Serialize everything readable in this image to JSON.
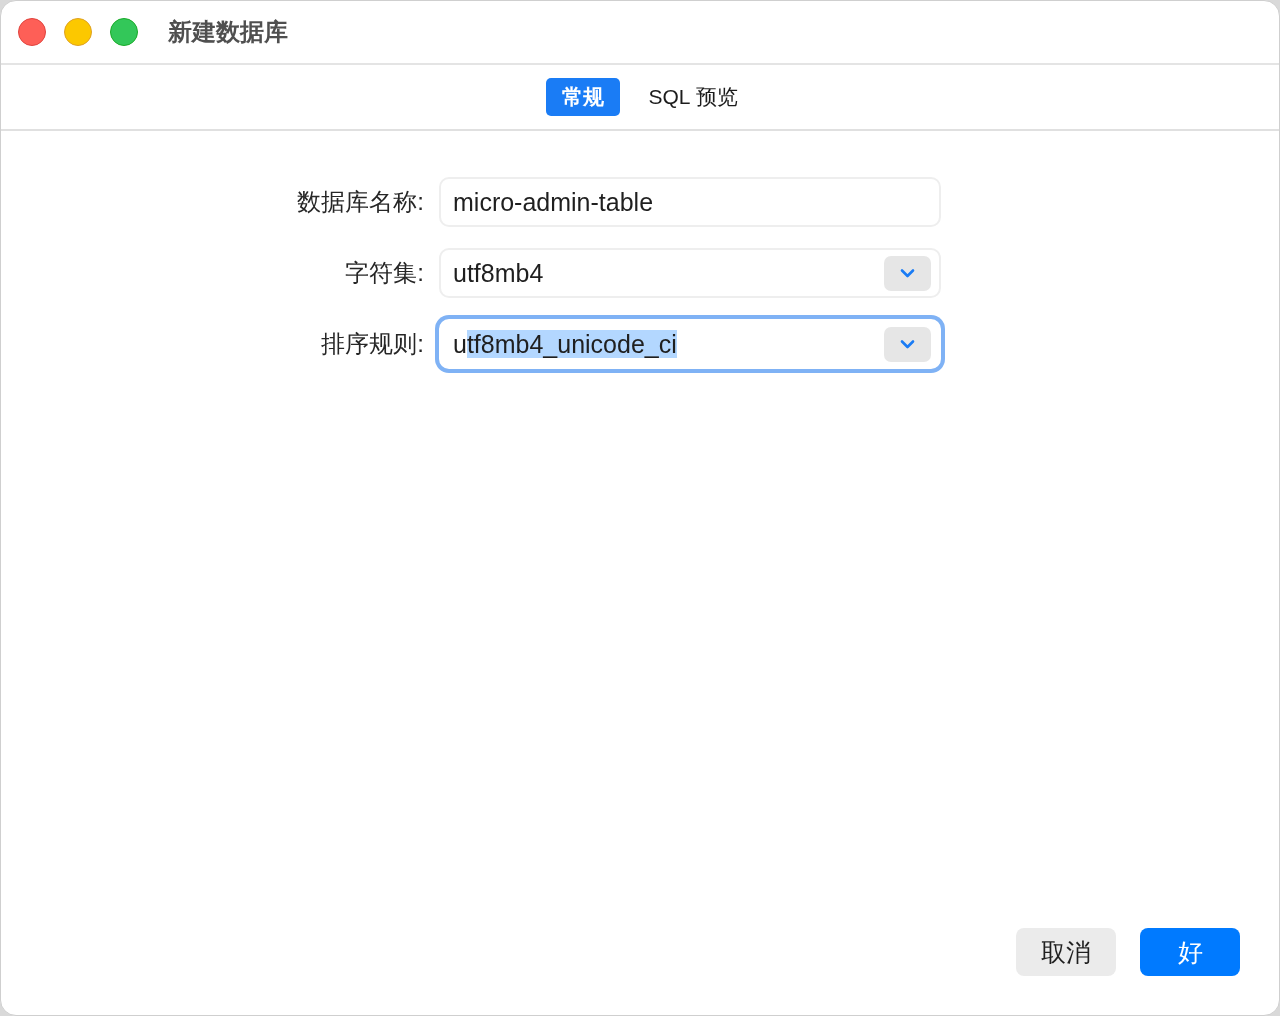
{
  "window": {
    "title": "新建数据库"
  },
  "tabs": [
    {
      "label": "常规",
      "selected": true
    },
    {
      "label": "SQL 预览",
      "selected": false
    }
  ],
  "form": {
    "fields": [
      {
        "label": "数据库名称:",
        "kind": "text",
        "value": "micro-admin-table",
        "focused": false
      },
      {
        "label": "字符集:",
        "kind": "select",
        "value": "utf8mb4",
        "focused": false
      },
      {
        "label": "排序规则:",
        "kind": "select",
        "value": "u",
        "selected_text": "tf8mb4_unicode_ci",
        "focused": true
      }
    ]
  },
  "buttons": [
    {
      "label": "取消",
      "kind": "secondary"
    },
    {
      "label": "好",
      "kind": "primary"
    }
  ]
}
